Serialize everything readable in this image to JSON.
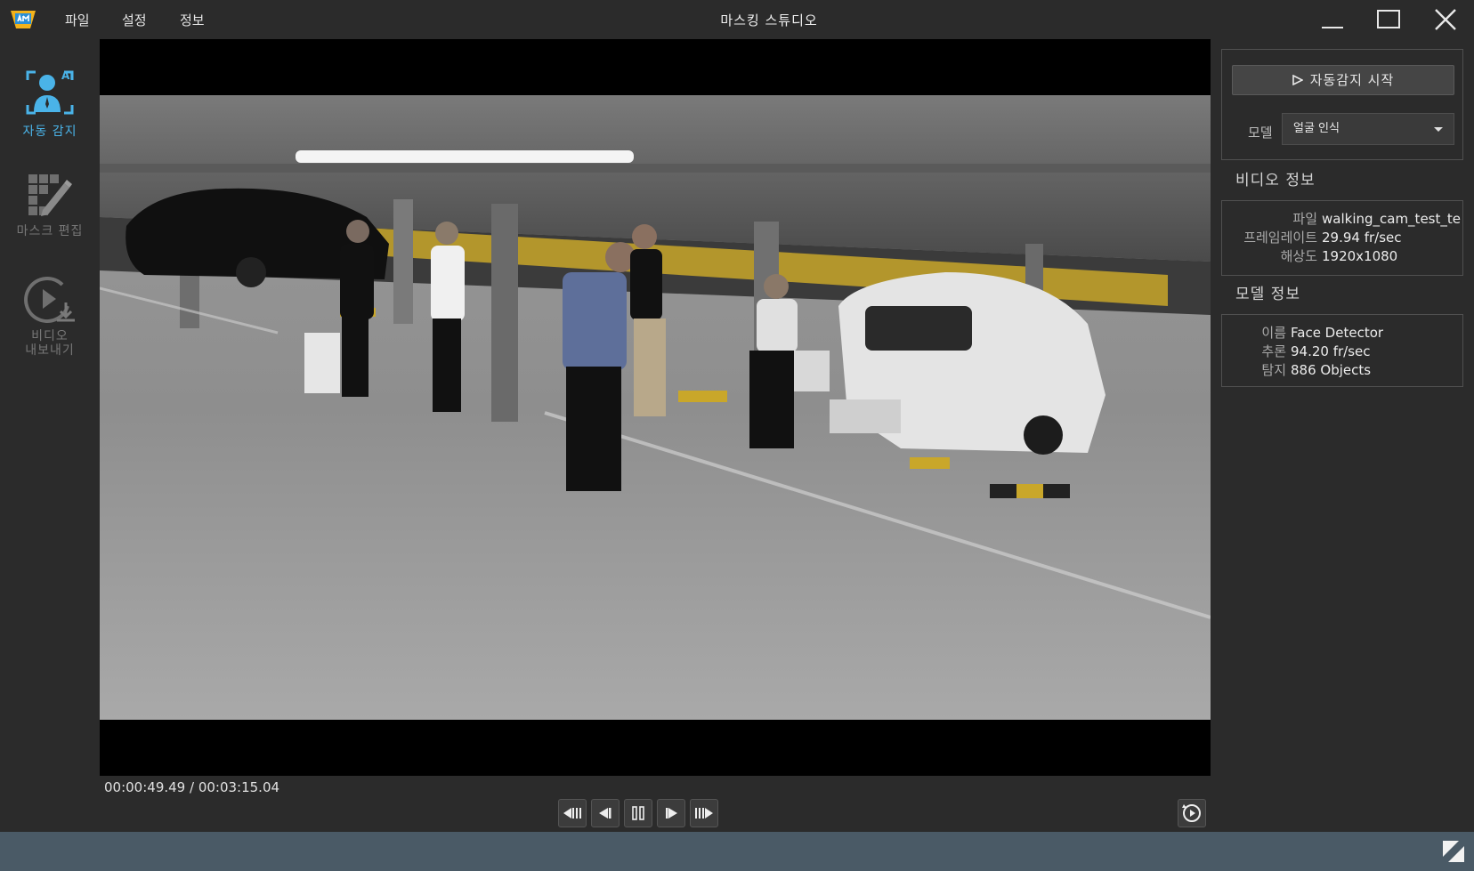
{
  "app": {
    "title": "마스킹 스튜디오",
    "menu": [
      "파일",
      "설정",
      "정보"
    ]
  },
  "sidebar": {
    "items": [
      {
        "label": "자동 감지",
        "icon": "ai-face-detect-icon",
        "active": true
      },
      {
        "label": "마스크 편집",
        "icon": "mask-edit-icon",
        "active": false
      },
      {
        "label_line1": "비디오",
        "label_line2": "내보내기",
        "icon": "video-export-icon",
        "active": false
      }
    ]
  },
  "player": {
    "timecode": "00:00:49.49 / 00:03:15.04",
    "controls": [
      "skip-back",
      "step-back",
      "pause",
      "step-forward",
      "skip-forward"
    ]
  },
  "panel": {
    "start_button": "자동감지 시작",
    "model_label": "모델",
    "model_value": "얼굴 인식",
    "video_info": {
      "title": "비디오 정보",
      "rows": [
        {
          "key": "파일",
          "value": "walking_cam_test_te"
        },
        {
          "key": "프레임레이트",
          "value": "29.94 fr/sec"
        },
        {
          "key": "해상도",
          "value": "1920x1080"
        }
      ]
    },
    "model_info": {
      "title": "모델 정보",
      "rows": [
        {
          "key": "이름",
          "value": "Face Detector"
        },
        {
          "key": "추론",
          "value": "94.20 fr/sec"
        },
        {
          "key": "탐지",
          "value": "886 Objects"
        }
      ]
    }
  },
  "colors": {
    "background": "#2b2b2b",
    "accent": "#4ab3e8",
    "statusbar": "#4a5a66",
    "inactive": "#777777"
  }
}
